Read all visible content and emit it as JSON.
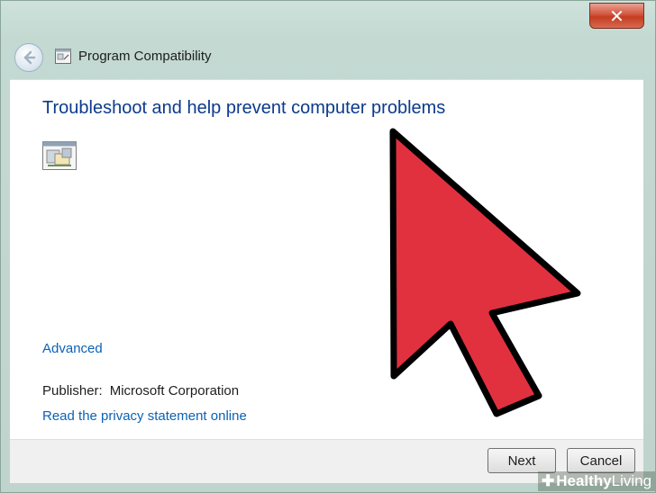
{
  "window": {
    "close_glyph": "✕"
  },
  "nav": {
    "back_icon": "back-arrow-icon",
    "app_icon": "program-compatibility-icon",
    "title": "Program Compatibility"
  },
  "content": {
    "heading": "Troubleshoot and help prevent computer problems",
    "program_icon": "program-icon",
    "advanced_link": "Advanced",
    "publisher_label": "Publisher:",
    "publisher_value": "Microsoft Corporation",
    "privacy_link": "Read the privacy statement online"
  },
  "footer": {
    "next_label": "Next",
    "cancel_label": "Cancel"
  },
  "overlay": {
    "cursor_icon": "red-arrow-cursor-icon",
    "cursor_color": "#e1313f",
    "watermark_symbol": "✚",
    "watermark_word1": "Healthy",
    "watermark_word2": "Living"
  }
}
